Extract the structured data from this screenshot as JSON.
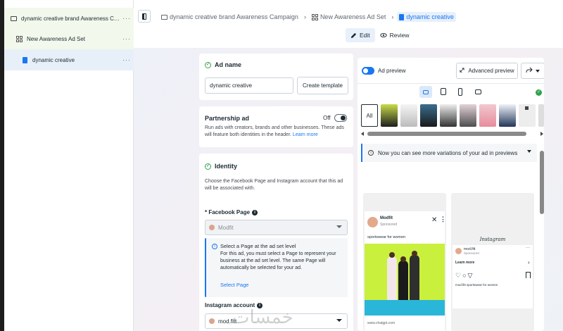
{
  "sidebar": {
    "campaign": "dynamic creative brand Awareness Camp...",
    "adset": "New Awareness Ad Set",
    "ad": "dynamic creative",
    "more": "···"
  },
  "breadcrumb": {
    "campaign": "dynamic creative brand Awareness Campaign",
    "adset": "New Awareness Ad Set",
    "ad": "dynamic creative",
    "sep": "›"
  },
  "modes": {
    "edit": "Edit",
    "review": "Review"
  },
  "ad_name": {
    "title": "Ad name",
    "value": "dynamic creative",
    "create_template": "Create template"
  },
  "partnership": {
    "title": "Partnership ad",
    "toggle": "Off",
    "desc": "Run ads with creators, brands and other businesses. These ads will feature both identities in the header.",
    "learn_more": "Learn more"
  },
  "identity": {
    "title": "Identity",
    "desc": "Choose the Facebook Page and Instagram account that this ad will be associated with.",
    "fb_label": "* Facebook Page",
    "fb_value": "Modfit",
    "info_title": "Select a Page at the ad set level",
    "info_body": "For this ad, you must select a Page to represent your business at the ad set level. The same Page will automatically be selected for your ad.",
    "info_link": "Select Page",
    "ig_label": "Instagram account",
    "ig_value": "mod.fitt"
  },
  "preview": {
    "label": "Ad preview",
    "advanced": "Advanced preview",
    "filter_all": "All",
    "notice": "Now you can see more variations of your ad in previews",
    "fb": {
      "name": "Modfit",
      "sponsored": "Sponsored",
      "caption": "sportswear for women",
      "url": "www.chatgpt.com"
    },
    "ig": {
      "brand": "Instagram",
      "name": "mod.fitt",
      "sponsored": "Sponsored",
      "cta": "Learn more",
      "caption": "mod.fitt sportswear for women"
    }
  },
  "watermark": "خمسات"
}
